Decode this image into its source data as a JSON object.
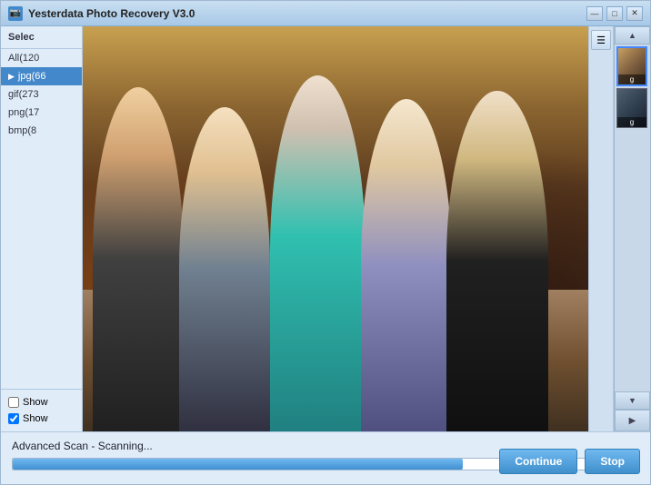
{
  "window": {
    "title": "Yesterdata Photo Recovery V3.0",
    "icon": "📷"
  },
  "titlebar": {
    "minimize_label": "—",
    "maximize_label": "□",
    "close_label": "✕"
  },
  "sidebar": {
    "header": "Selec",
    "items": [
      {
        "label": "All(120",
        "count": 120,
        "active": false
      },
      {
        "label": "jpg(66",
        "count": 66,
        "active": true
      },
      {
        "label": "gif(273",
        "count": 273,
        "active": false
      },
      {
        "label": "png(17",
        "count": 17,
        "active": false
      },
      {
        "label": "bmp(8",
        "count": 8,
        "active": false
      }
    ],
    "checkboxes": [
      {
        "label": "Show",
        "checked": false
      },
      {
        "label": "Show",
        "checked": true
      }
    ]
  },
  "thumbnails": [
    {
      "label": "g",
      "selected": true,
      "bg": "thumb-item-bg-1"
    },
    {
      "label": "g",
      "selected": false,
      "bg": "thumb-item-bg-2"
    }
  ],
  "iconbar": {
    "icon": "☰"
  },
  "status": {
    "text": "Advanced Scan - Scanning...",
    "progress_percent": 72
  },
  "buttons": {
    "continue_label": "Continue",
    "stop_label": "Stop"
  }
}
